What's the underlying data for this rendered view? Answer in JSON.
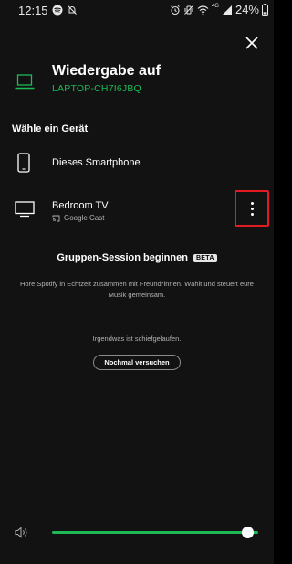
{
  "status_bar": {
    "time": "12:15",
    "left_icons": [
      "spotify-icon",
      "mute-icon"
    ],
    "right_icons": [
      "alarm-icon",
      "vibrate-off-icon",
      "wifi-icon",
      "signal-icon"
    ],
    "network_label": "4G",
    "battery": "24%"
  },
  "header": {
    "icon": "laptop-icon",
    "title": "Wiedergabe auf",
    "device": "LAPTOP-CH7I6JBQ"
  },
  "section_title": "Wähle ein Gerät",
  "devices": [
    {
      "icon": "smartphone-icon",
      "name": "Dieses Smartphone"
    },
    {
      "icon": "tv-icon",
      "name": "Bedroom TV",
      "sub_icon": "cast-icon",
      "sub": "Google Cast"
    }
  ],
  "group_session": {
    "title": "Gruppen-Session beginnen",
    "badge": "BETA",
    "description": "Höre Spotify in Echtzeit zusammen mit Freund*innen. Wählt und steuert eure Musik gemeinsam."
  },
  "error": {
    "message": "Irgendwas ist schiefgelaufen.",
    "retry_label": "Nochmal versuchen"
  },
  "volume": {
    "level": 0.95
  },
  "colors": {
    "accent": "#1db954",
    "background": "#121212",
    "highlight_box": "#e21b23"
  }
}
